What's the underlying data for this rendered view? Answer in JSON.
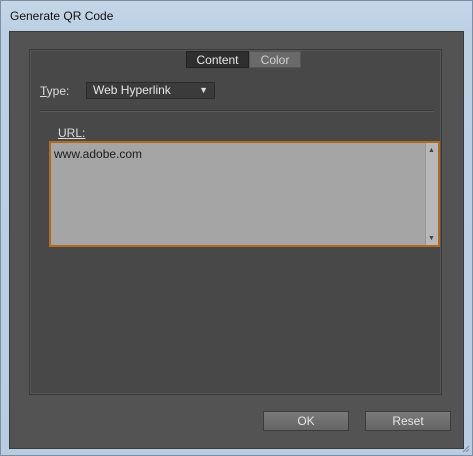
{
  "window": {
    "title": "Generate QR Code"
  },
  "tabs": [
    {
      "label": "Content",
      "active": true
    },
    {
      "label": "Color",
      "active": false
    }
  ],
  "type_field": {
    "label_prefix": "T",
    "label_rest": "ype:",
    "selected": "Web Hyperlink"
  },
  "url_field": {
    "label_u": "U",
    "label_rest": "RL:",
    "value": "www.adobe.com"
  },
  "buttons": {
    "ok": "OK",
    "reset": "Reset"
  },
  "colors": {
    "accent_border": "#b06b1e",
    "panel_bg": "#484848",
    "client_bg": "#535353"
  }
}
